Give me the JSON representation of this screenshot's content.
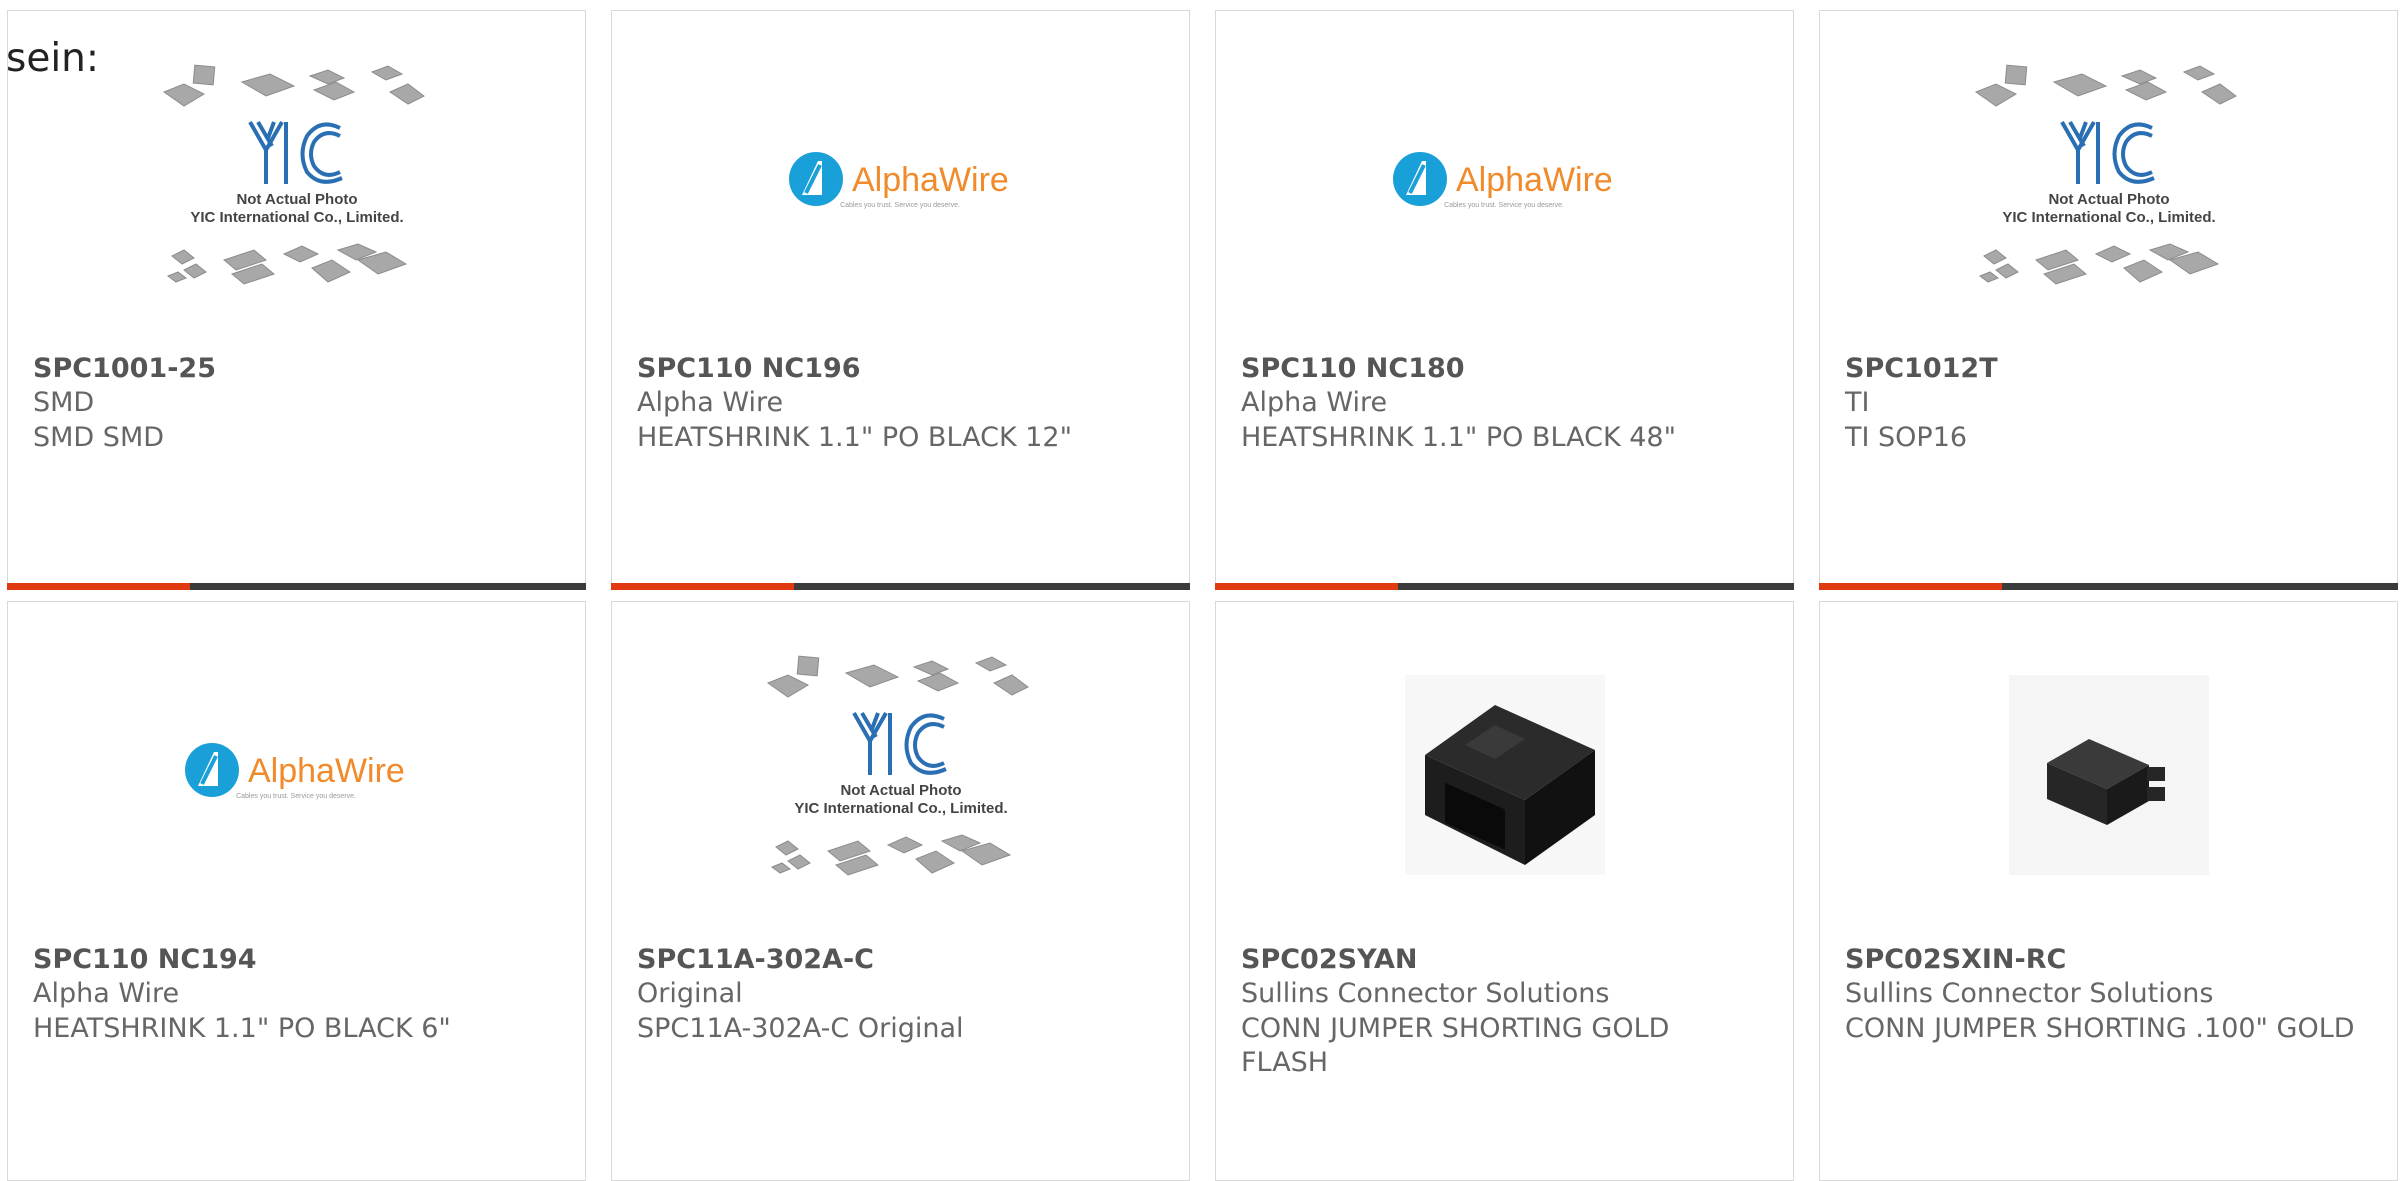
{
  "heading": "sein:",
  "placeholder": {
    "line1": "Not Actual Photo",
    "line2": "YIC International Co., Limited.",
    "logo": "YIC"
  },
  "alphawire": {
    "name": "AlphaWire",
    "tagline": "Cables you trust. Service you deserve."
  },
  "colors": {
    "accent": "#e23a10",
    "bar": "#3b3b3b",
    "alpha_blue": "#1aa0d8",
    "alpha_orange": "#f08a2a",
    "yic_blue": "#2a6fb3"
  },
  "products": [
    {
      "title": "SPC1001-25",
      "brand": "SMD",
      "desc": "SMD SMD",
      "image": "yic-placeholder",
      "active": true
    },
    {
      "title": "SPC110 NC196",
      "brand": "Alpha Wire",
      "desc": "HEATSHRINK 1.1\" PO BLACK 12\"",
      "image": "alphawire-logo",
      "active": true
    },
    {
      "title": "SPC110 NC180",
      "brand": "Alpha Wire",
      "desc": "HEATSHRINK 1.1\" PO BLACK 48\"",
      "image": "alphawire-logo",
      "active": true
    },
    {
      "title": "SPC1012T",
      "brand": "TI",
      "desc": "TI SOP16",
      "image": "yic-placeholder",
      "active": true
    },
    {
      "title": "SPC110 NC194",
      "brand": "Alpha Wire",
      "desc": "HEATSHRINK 1.1\" PO BLACK 6\"",
      "image": "alphawire-logo",
      "active": false
    },
    {
      "title": "SPC11A-302A-C",
      "brand": "Original",
      "desc": "SPC11A-302A-C Original",
      "image": "yic-placeholder",
      "active": false
    },
    {
      "title": "SPC02SYAN",
      "brand": "Sullins Connector Solutions",
      "desc": "CONN JUMPER SHORTING GOLD FLASH",
      "image": "jumper-large",
      "active": false
    },
    {
      "title": "SPC02SXIN-RC",
      "brand": "Sullins Connector Solutions",
      "desc": "CONN JUMPER SHORTING .100\" GOLD",
      "image": "jumper-small",
      "active": false
    }
  ]
}
